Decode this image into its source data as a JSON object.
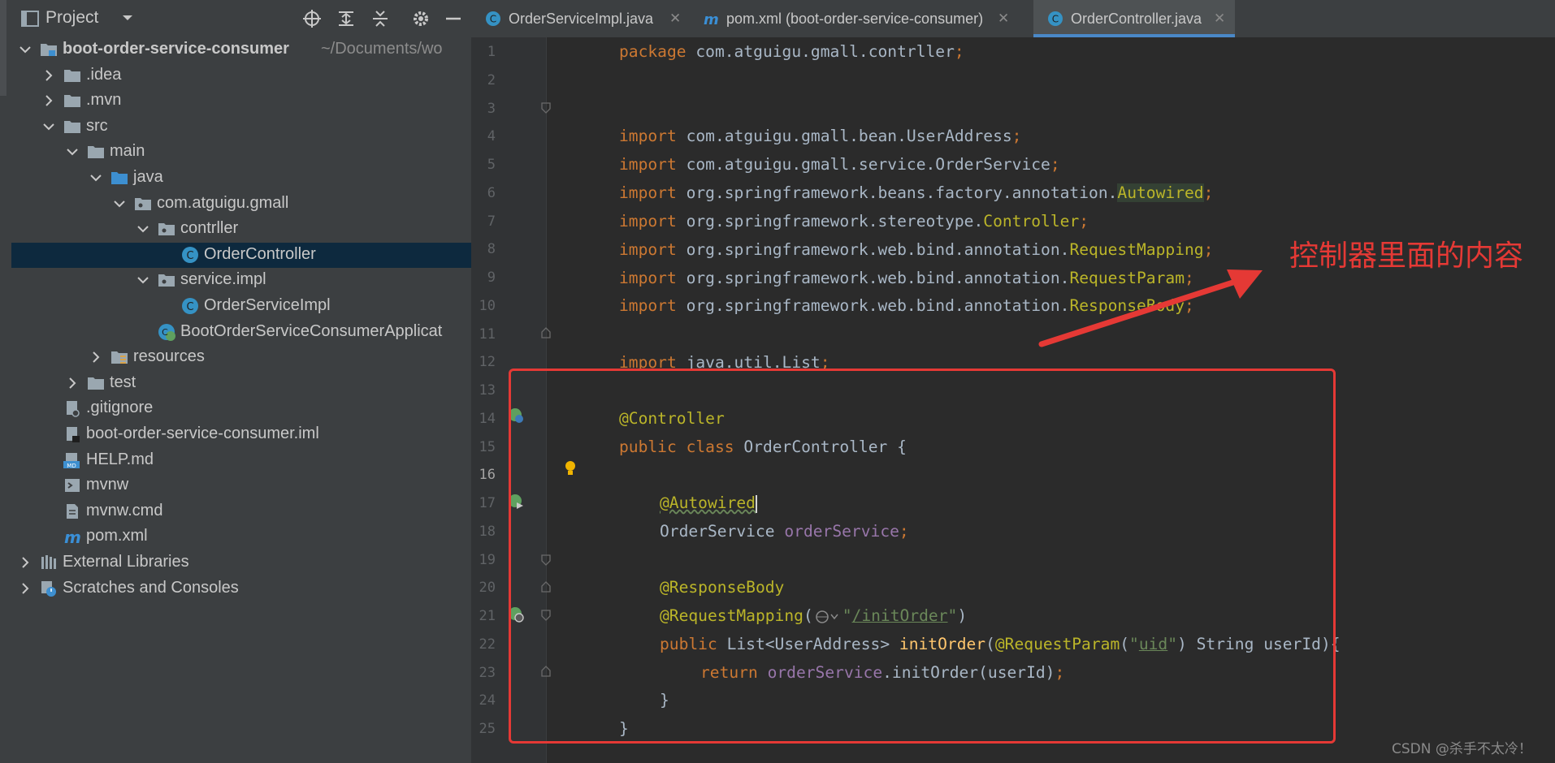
{
  "project_panel": {
    "title": "Project",
    "tree": [
      {
        "label": "boot-order-service-consumer",
        "path": "~/Documents/wo",
        "icon": "module-folder-icon",
        "expanded": true,
        "bold": true
      },
      {
        "label": ".idea",
        "icon": "folder-icon",
        "expanded": false
      },
      {
        "label": ".mvn",
        "icon": "folder-icon",
        "expanded": false
      },
      {
        "label": "src",
        "icon": "folder-icon",
        "expanded": true
      },
      {
        "label": "main",
        "icon": "folder-icon",
        "expanded": true
      },
      {
        "label": "java",
        "icon": "source-folder-icon",
        "expanded": true
      },
      {
        "label": "com.atguigu.gmall",
        "icon": "package-icon",
        "expanded": true
      },
      {
        "label": "contrller",
        "icon": "package-icon",
        "expanded": true
      },
      {
        "label": "OrderController",
        "icon": "java-class-icon",
        "selected": true
      },
      {
        "label": "service.impl",
        "icon": "package-icon",
        "expanded": true
      },
      {
        "label": "OrderServiceImpl",
        "icon": "java-class-icon"
      },
      {
        "label": "BootOrderServiceConsumerApplicat",
        "icon": "spring-boot-class-icon"
      },
      {
        "label": "resources",
        "icon": "resources-folder-icon",
        "expanded": false
      },
      {
        "label": "test",
        "icon": "folder-icon",
        "expanded": false
      },
      {
        "label": ".gitignore",
        "icon": "gitignore-file-icon"
      },
      {
        "label": "boot-order-service-consumer.iml",
        "icon": "iml-file-icon"
      },
      {
        "label": "HELP.md",
        "icon": "markdown-file-icon"
      },
      {
        "label": "mvnw",
        "icon": "shell-file-icon"
      },
      {
        "label": "mvnw.cmd",
        "icon": "text-file-icon"
      },
      {
        "label": "pom.xml",
        "icon": "maven-file-icon"
      },
      {
        "label": "External Libraries",
        "icon": "libraries-icon",
        "expanded": false
      },
      {
        "label": "Scratches and Consoles",
        "icon": "scratches-icon",
        "expanded": false
      }
    ]
  },
  "tabs": [
    {
      "label": "OrderServiceImpl.java",
      "icon": "java-class-icon",
      "active": false
    },
    {
      "label": "pom.xml (boot-order-service-consumer)",
      "icon": "maven-file-icon",
      "active": false
    },
    {
      "label": "OrderController.java",
      "icon": "java-class-icon",
      "active": true
    }
  ],
  "editor": {
    "line_numbers": [
      "1",
      "2",
      "3",
      "4",
      "5",
      "6",
      "7",
      "8",
      "9",
      "10",
      "11",
      "12",
      "13",
      "14",
      "15",
      "16",
      "17",
      "18",
      "19",
      "20",
      "21",
      "22",
      "23",
      "24",
      "25"
    ],
    "current_line": "16",
    "lines": {
      "l1": [
        "package",
        " com.atguigu.gmall.contrller",
        ";"
      ],
      "l3": [
        "import",
        " com.atguigu.gmall.bean.UserAddress",
        ";"
      ],
      "l4": [
        "import",
        " com.atguigu.gmall.service.OrderService",
        ";"
      ],
      "l5": [
        "import",
        " org.springframework.beans.factory.annotation.",
        "Autowired",
        ";"
      ],
      "l6": [
        "import",
        " org.springframework.stereotype.",
        "Controller",
        ";"
      ],
      "l7": [
        "import",
        " org.springframework.web.bind.annotation.",
        "RequestMapping",
        ";"
      ],
      "l8": [
        "import",
        " org.springframework.web.bind.annotation.",
        "RequestParam",
        ";"
      ],
      "l9": [
        "import",
        " org.springframework.web.bind.annotation.",
        "ResponseBody",
        ";"
      ],
      "l11": [
        "import",
        " java.util.List",
        ";"
      ],
      "l13": [
        "@Controller"
      ],
      "l14": [
        "public class",
        " OrderController {"
      ],
      "l16": [
        "@Autowired"
      ],
      "l17": [
        "OrderService ",
        "orderService",
        ";"
      ],
      "l19": [
        "@ResponseBody"
      ],
      "l20": [
        "@RequestMapping",
        "(",
        "\"",
        "/initOrder",
        "\"",
        ")"
      ],
      "l21": [
        "public",
        " List<UserAddress> ",
        "initOrder",
        "(",
        "@RequestParam",
        "(",
        "\"",
        "uid",
        "\"",
        ") String userId){"
      ],
      "l22": [
        "return",
        " ",
        "orderService",
        ".initOrder(userId)",
        ";"
      ],
      "l23": [
        "}"
      ],
      "l24": [
        "}"
      ]
    }
  },
  "annotation": {
    "text": "控制器里面的内容",
    "color": "#e53935"
  },
  "watermark": "CSDN @杀手不太冷！",
  "colors": {
    "keyword": "#cc7832",
    "annotation": "#bbb529",
    "class_ref": "#ffc66d",
    "field": "#9876aa",
    "string": "#6a8759",
    "accent": "#4a88c7"
  }
}
